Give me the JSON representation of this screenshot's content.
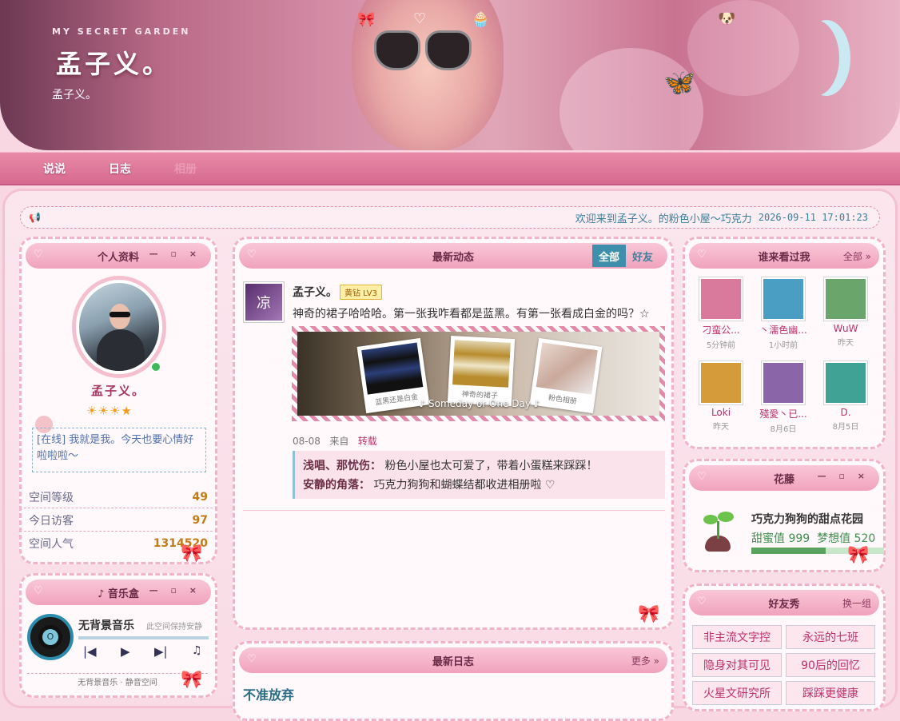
{
  "banner": {
    "subtitle": "MY SECRET GARDEN",
    "title": "孟子义。",
    "title_small": "孟子义。"
  },
  "nav": {
    "items": [
      "说说",
      "日志",
      "相册"
    ]
  },
  "ticker": {
    "text": "欢迎来到孟子义。的粉色小屋～巧克力",
    "time": "2026-09-11 17:01:23"
  },
  "profile": {
    "title": "个人资料",
    "controls": "— ▫ ×",
    "name": "孟子义。",
    "status": "[在线] 我就是我。今天也要心情好啦啦啦～",
    "stats": [
      {
        "label": "空间等级",
        "value": "49"
      },
      {
        "label": "今日访客",
        "value": "97"
      },
      {
        "label": "空间人气",
        "value": "1314520"
      }
    ]
  },
  "music": {
    "title": "♪ 音乐盒",
    "track": "无背景音乐",
    "note": "此空间保持安静",
    "footer": "无背景音乐 · 静音空间"
  },
  "feed": {
    "title": "最新动态",
    "tabs": [
      "全部",
      "好友"
    ],
    "avatar_char": "凉",
    "user": "孟子义。",
    "badge": "黄钻 LV3",
    "text": "神奇的裙子哈哈哈。第一张我咋看都是蓝黑。有第一张看成白金的吗？☆",
    "photos": [
      {
        "caption": "蓝黑还是白金"
      },
      {
        "caption": "神奇的裙子"
      },
      {
        "caption": "粉色相册"
      }
    ],
    "photo_overlay": "♪ Someday or One Day ♪",
    "date": "08-08",
    "from": "来自",
    "action": "转载",
    "comments": [
      {
        "author": "浅唱、那忧伤：",
        "text": "粉色小屋也太可爱了，带着小蛋糕来踩踩！"
      },
      {
        "author": "安静的角落：",
        "text": "巧克力狗狗和蝴蝶结都收进相册啦 ♡"
      }
    ]
  },
  "blog": {
    "title": "最新日志",
    "more": "更多 »",
    "entry": "不准放弃"
  },
  "visitors": {
    "title": "谁来看过我",
    "more": "全部 »",
    "items": [
      {
        "name": "刁蛮公...",
        "time": "5分钟前",
        "color": "#d9799c"
      },
      {
        "name": "丶濡色幽...",
        "time": "1小时前",
        "color": "#4b9ec3"
      },
      {
        "name": "WuW",
        "time": "昨天",
        "color": "#6aa66b"
      },
      {
        "name": "Loki",
        "time": "昨天",
        "color": "#d59b3a"
      },
      {
        "name": "殘愛丶已...",
        "time": "8月6日",
        "color": "#8a66a8"
      },
      {
        "name": "D.",
        "time": "8月5日",
        "color": "#3fa295"
      }
    ]
  },
  "garden": {
    "title": "花藤",
    "name": "巧克力狗狗的甜点花园",
    "sweet_label": "甜蜜值",
    "sweet": "999",
    "dream_label": "梦想值",
    "dream": "520",
    "progress": 0.56
  },
  "friends": {
    "title": "好友秀",
    "action": "换一组",
    "items": [
      "非主流文字控",
      "永远的七班",
      "隐身对其可见",
      "90后的回忆",
      "火星文研究所",
      "踩踩更健康"
    ]
  },
  "colors": {
    "accent": "#e98aa8",
    "link": "#3e8fac",
    "name": "#c0306a"
  }
}
